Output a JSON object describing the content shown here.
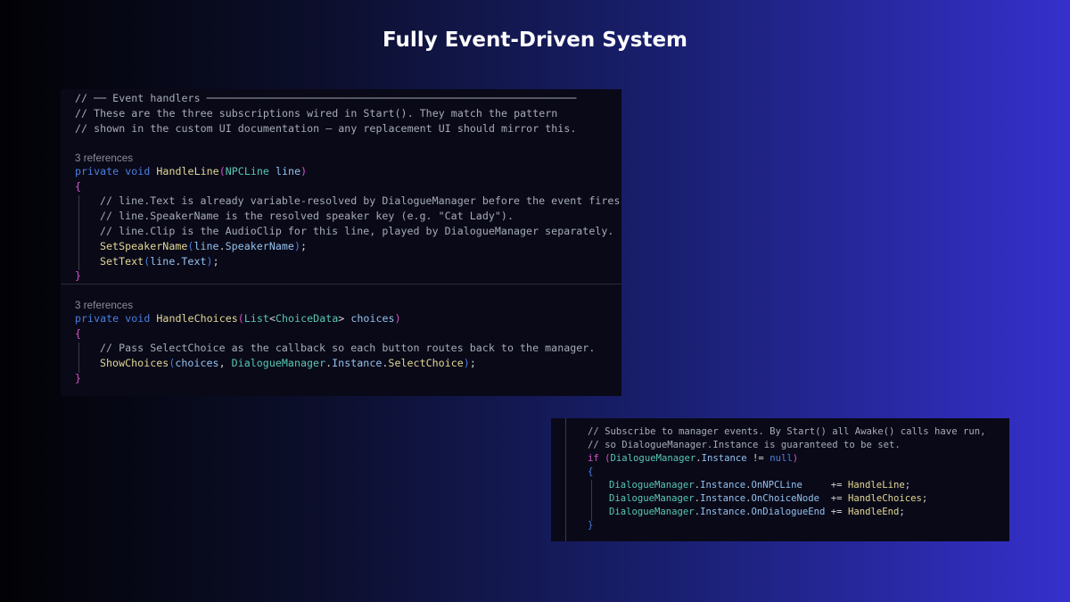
{
  "slide": {
    "title": "Fully Event-Driven System"
  },
  "top_panel": {
    "lines": [
      "// ── Event handlers ───────────────────────────────────────────────────────────",
      "// These are the three subscriptions wired in Start(). They match the pattern",
      "// shown in the custom UI documentation — any replacement UI should mirror this."
    ],
    "handle_line": {
      "references": "3 references",
      "signature": {
        "kw": "private",
        "ret": "void",
        "name": "HandleLine",
        "ptype": "NPCLine",
        "pname": "line"
      },
      "comments": [
        "// line.Text is already variable-resolved by DialogueManager before the event fires.",
        "// line.SpeakerName is the resolved speaker key (e.g. \"Cat Lady\").",
        "// line.Clip is the AudioClip for this line, played by DialogueManager separately."
      ],
      "call1": {
        "fn": "SetSpeakerName",
        "obj": "line",
        "prop": "SpeakerName"
      },
      "call2": {
        "fn": "SetText",
        "obj": "line",
        "prop": "Text"
      }
    },
    "handle_choices": {
      "references": "3 references",
      "signature": {
        "kw": "private",
        "ret": "void",
        "name": "HandleChoices",
        "gen": "List",
        "targ": "ChoiceData",
        "pname": "choices"
      },
      "comment": "// Pass SelectChoice as the callback so each button routes back to the manager.",
      "call": {
        "fn": "ShowChoices",
        "arg1": "choices",
        "cls": "DialogueManager",
        "prop": "Instance",
        "method": "SelectChoice"
      }
    }
  },
  "bottom_panel": {
    "comments": [
      "// Subscribe to manager events. By Start() all Awake() calls have run,",
      "// so DialogueManager.Instance is guaranteed to be set."
    ],
    "if_line": {
      "kw": "if",
      "cls": "DialogueManager",
      "prop": "Instance",
      "op": "!=",
      "null": "null"
    },
    "subs": [
      {
        "cls": "DialogueManager",
        "inst": "Instance",
        "event": "OnNPCLine",
        "pad": "     ",
        "handler": "HandleLine"
      },
      {
        "cls": "DialogueManager",
        "inst": "Instance",
        "event": "OnChoiceNode",
        "pad": "  ",
        "handler": "HandleChoices"
      },
      {
        "cls": "DialogueManager",
        "inst": "Instance",
        "event": "OnDialogueEnd",
        "pad": " ",
        "handler": "HandleEnd"
      }
    ]
  }
}
